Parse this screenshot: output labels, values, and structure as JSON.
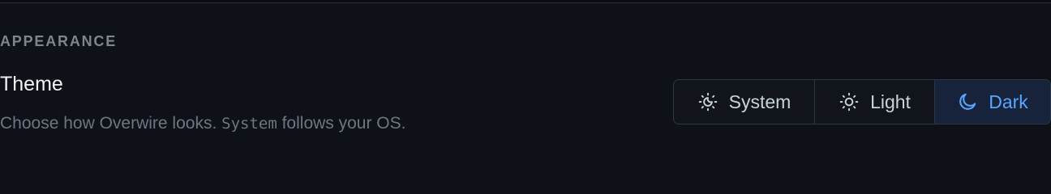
{
  "section": {
    "heading": "APPEARANCE"
  },
  "theme_setting": {
    "title": "Theme",
    "description_before": "Choose how Overwire looks. ",
    "description_code": "System",
    "description_after": " follows your OS.",
    "selected": "Dark",
    "options": [
      {
        "label": "System",
        "icon": "sun-moon-icon"
      },
      {
        "label": "Light",
        "icon": "sun-icon"
      },
      {
        "label": "Dark",
        "icon": "moon-icon"
      }
    ]
  },
  "colors": {
    "background": "#0e1117",
    "accent": "#58a6ff",
    "selected_bg": "#17233a"
  }
}
